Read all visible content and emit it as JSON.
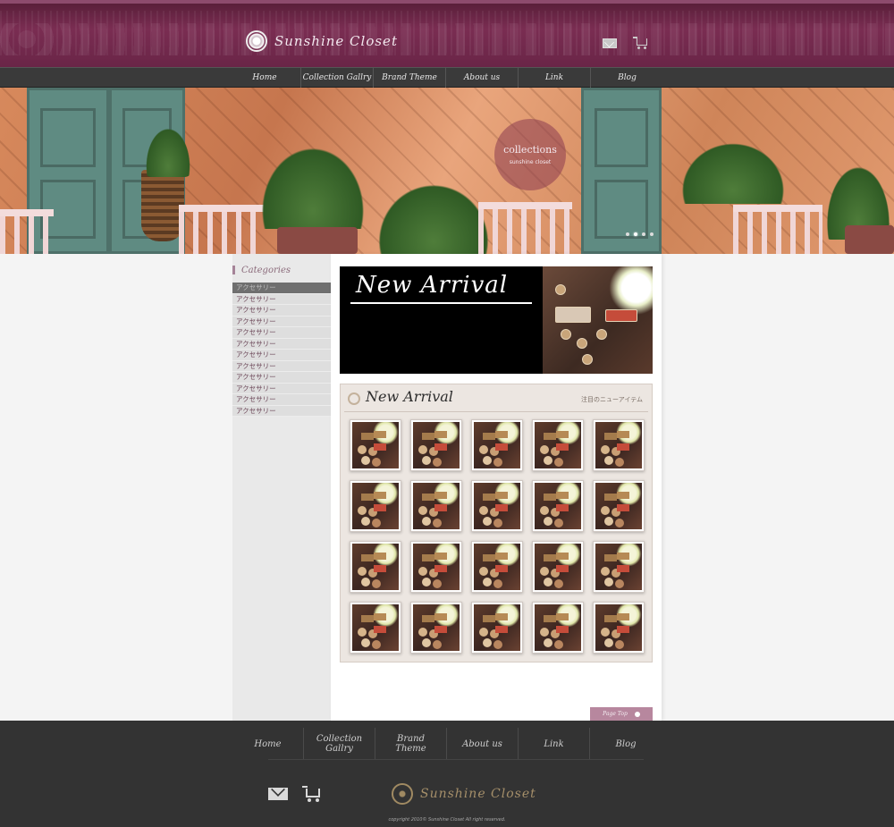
{
  "header": {
    "logo_text": "Sunshine Closet",
    "icons": [
      "mail-icon",
      "cart-icon"
    ]
  },
  "nav": {
    "items": [
      "Home",
      "Collection Gallry",
      "Brand Theme",
      "About us",
      "Link",
      "Blog"
    ]
  },
  "hero": {
    "badge_title": "collections",
    "badge_sub": "sunshine closet",
    "slide_count": 4,
    "active_slide": 1
  },
  "sidebar": {
    "heading": "Categories",
    "items": [
      "アクセサリー",
      "アクセサリー",
      "アクセサリー",
      "アクセサリー",
      "アクセサリー",
      "アクセサリー",
      "アクセサリー",
      "アクセサリー",
      "アクセサリー",
      "アクセサリー",
      "アクセサリー",
      "アクセサリー"
    ],
    "active_index": 0
  },
  "banner": {
    "title": "New Arrival"
  },
  "arrivals": {
    "title": "New Arrival",
    "subtitle": "注目のニューアイテム",
    "thumb_count": 20
  },
  "page_top": {
    "label": "Page Top"
  },
  "footer": {
    "nav": [
      "Home",
      "Collection\nGallry",
      "Brand\nTheme",
      "About us",
      "Link",
      "Blog"
    ],
    "logo_text": "Sunshine Closet",
    "copyright": "copyright 2010© Sunshine Closet All right reserved."
  },
  "colors": {
    "brand_plum": "#6a2547",
    "nav_bg": "#3a3a3a",
    "footer_bg": "#333333",
    "accent_pink": "#b7879e"
  }
}
